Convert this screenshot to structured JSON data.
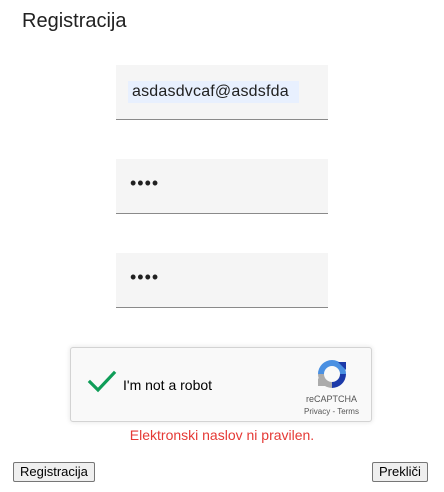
{
  "page": {
    "title": "Registracija"
  },
  "form": {
    "email_value": "asdasdvcaf@asdsfda",
    "password_mask": "••••",
    "confirm_password_mask": "••••"
  },
  "captcha": {
    "label": "I'm not a robot",
    "brand": "reCAPTCHA",
    "links": "Privacy - Terms",
    "checked": true,
    "check_color": "#0f9d58"
  },
  "error": {
    "message": "Elektronski naslov ni pravilen.",
    "color": "#e53935"
  },
  "buttons": {
    "register": "Registracija",
    "cancel": "Prekliči"
  }
}
